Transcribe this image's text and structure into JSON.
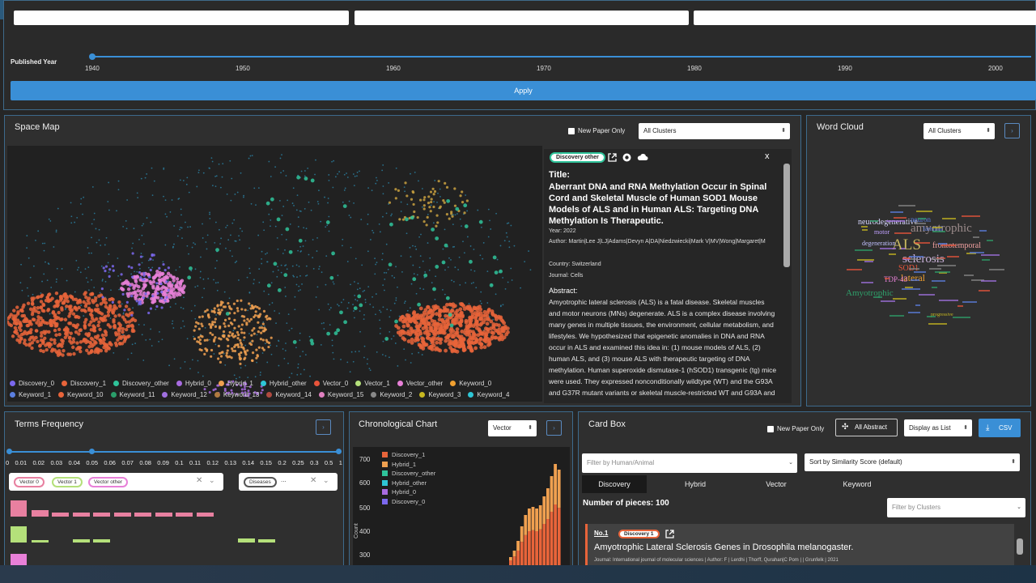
{
  "filters": {
    "published_year_label": "Published Year",
    "years": [
      "1940",
      "1950",
      "1960",
      "1970",
      "1980",
      "1990",
      "2000"
    ],
    "apply_label": "Apply"
  },
  "space_map": {
    "title": "Space Map",
    "new_paper_only_label": "New Paper Only",
    "cluster_select": "All Clusters",
    "legend": [
      {
        "label": "Discovery_0",
        "color": "#7b68ee"
      },
      {
        "label": "Discovery_1",
        "color": "#e8643a"
      },
      {
        "label": "Discovery_other",
        "color": "#2fc39a"
      },
      {
        "label": "Hybrid_0",
        "color": "#a86be0"
      },
      {
        "label": "Hybrid_1",
        "color": "#f0a050"
      },
      {
        "label": "Hybrid_other",
        "color": "#2ec6d6"
      },
      {
        "label": "Vector_0",
        "color": "#e8543a"
      },
      {
        "label": "Vector_1",
        "color": "#b4e07a"
      },
      {
        "label": "Vector_other",
        "color": "#e880d8"
      },
      {
        "label": "Keyword_0",
        "color": "#f0a030"
      },
      {
        "label": "Keyword_1",
        "color": "#5b7fe0"
      },
      {
        "label": "Keyword_10",
        "color": "#e8643a"
      },
      {
        "label": "Keyword_11",
        "color": "#2a9e6a"
      },
      {
        "label": "Keyword_12",
        "color": "#a070e0"
      },
      {
        "label": "Keyword_13",
        "color": "#b07a40"
      },
      {
        "label": "Keyword_14",
        "color": "#b04a40"
      },
      {
        "label": "Keyword_15",
        "color": "#e080c0"
      },
      {
        "label": "Keyword_2",
        "color": "#888888"
      },
      {
        "label": "Keyword_3",
        "color": "#c8b820"
      },
      {
        "label": "Keyword_4",
        "color": "#2ec6d6"
      }
    ]
  },
  "detail": {
    "badge": "Discovery other",
    "close": "x",
    "title_label": "Title:",
    "title": "Aberrant DNA and RNA Methylation Occur in Spinal Cord and Skeletal Muscle of Human SOD1 Mouse Models of ALS and in Human ALS: Targeting DNA Methylation Is Therapeutic.",
    "year": "Year: 2022",
    "author": "Author: Martin|Lee J|LJ|Adams|Devyn A|DA|Niedzwiecki|Mark V|MV|Wong|Margaret|M",
    "country": "Country: Switzerland",
    "journal": "Journal: Cells",
    "abstract_label": "Abstract:",
    "abstract": "Amyotrophic lateral sclerosis (ALS) is a fatal disease. Skeletal muscles and motor neurons (MNs) degenerate. ALS is a complex disease involving many genes in multiple tissues, the environment, cellular metabolism, and lifestyles. We hypothesized that epigenetic anomalies in DNA and RNA occur in ALS and examined this idea in: (1) mouse models of ALS, (2) human ALS, and (3) mouse ALS with therapeutic targeting of DNA methylation. Human superoxide dismutase-1 (hSOD1) transgenic (tg) mice were used. They expressed nonconditionally wildtype (WT) and the G93A and G37R mutant variants or skeletal muscle-restricted WT and G93A and"
  },
  "word_cloud": {
    "title": "Word Cloud",
    "cluster_select": "All Clusters",
    "words": [
      {
        "t": "amyotrophic",
        "c": "#9a8a8a",
        "s": 15
      },
      {
        "t": "ALS",
        "c": "#c8b860",
        "s": 19
      },
      {
        "t": "sclerosis",
        "c": "#c8b0d8",
        "s": 15
      },
      {
        "t": "neurodegenerative",
        "c": "#d8d8ff",
        "s": 10
      },
      {
        "t": "frontotemporal",
        "c": "#f0a0a0",
        "s": 10
      },
      {
        "t": "lateral",
        "c": "#f0a030",
        "s": 12
      },
      {
        "t": "Amyotrophic",
        "c": "#2ea06a",
        "s": 11
      },
      {
        "t": "SOD1",
        "c": "#e8543a",
        "s": 10
      },
      {
        "t": "TDP-43",
        "c": "#e880d8",
        "s": 9
      },
      {
        "t": "neuron",
        "c": "#5b7fe0",
        "s": 9
      },
      {
        "t": "degeneration",
        "c": "#c0c0ff",
        "s": 8
      },
      {
        "t": "motor",
        "c": "#c0a0ff",
        "s": 8
      },
      {
        "t": "familial",
        "c": "#5b7fe0",
        "s": 8
      },
      {
        "t": "progressive",
        "c": "#c8b820",
        "s": 6
      }
    ]
  },
  "terms_frequency": {
    "title": "Terms Frequency",
    "ticks": [
      "0",
      "0.01",
      "0.02",
      "0.03",
      "0.04",
      "0.05",
      "0.06",
      "0.07",
      "0.08",
      "0.09",
      "0.1",
      "0.11",
      "0.12",
      "0.13",
      "0.14",
      "0.15",
      "0.2",
      "0.25",
      "0.3",
      "0.5",
      "1"
    ],
    "chips_left": [
      "Vector 0",
      "Vector 1",
      "Vector other"
    ],
    "chips_right": [
      "Diseases",
      "..."
    ],
    "clear_icon": "✕",
    "row_colors": [
      "#e880a0",
      "#b4e07a",
      "#e880d8"
    ]
  },
  "chronological": {
    "title": "Chronological Chart",
    "select": "Vector",
    "y_label": "Count",
    "y_ticks": [
      "700",
      "600",
      "500",
      "400",
      "300"
    ],
    "legend": [
      {
        "label": "Discovery_1",
        "color": "#e8643a"
      },
      {
        "label": "Hybrid_1",
        "color": "#f0a050"
      },
      {
        "label": "Discovery_other",
        "color": "#2fc39a"
      },
      {
        "label": "Hybrid_other",
        "color": "#2ec6d6"
      },
      {
        "label": "Hybrid_0",
        "color": "#a86be0"
      },
      {
        "label": "Discovery_0",
        "color": "#7b68ee"
      }
    ]
  },
  "card_box": {
    "title": "Card Box",
    "new_paper_only_label": "New Paper Only",
    "all_abstract_label": "All Abstract",
    "display_select": "Display as List",
    "csv_label": "CSV",
    "filter_human_placeholder": "Filter by Human/Animal",
    "sort_select": "Sort by Similarity Score (default)",
    "tabs": [
      "Discovery",
      "Hybrid",
      "Vector",
      "Keyword"
    ],
    "pieces": "Number of pieces: 100",
    "cluster_filter_placeholder": "Filter by Clusters",
    "card": {
      "index": "No.1",
      "badge": "Discovery 1",
      "title": "Amyotrophic Lateral Sclerosis Genes in Drosophila melanogaster.",
      "meta": "Journal: International journal of molecular sciences | Author: F | Lerdhi | Thorff, Qurahan|C Pom | | Grunfelk | 2021"
    }
  }
}
